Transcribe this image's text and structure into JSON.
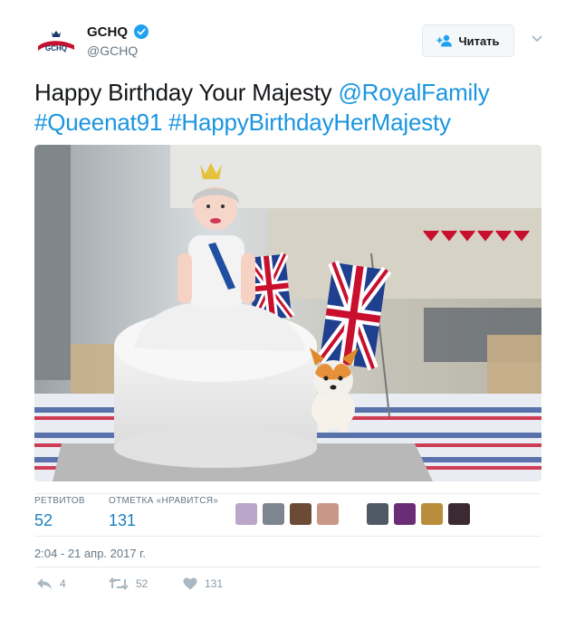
{
  "author": {
    "display_name": "GCHQ",
    "handle": "@GCHQ",
    "avatar_text": "GCHQ",
    "verified": true,
    "icon_verified": "verified-badge-icon"
  },
  "follow_button": {
    "label": "Читать",
    "icon": "follow-person-plus-icon"
  },
  "menu_caret": {
    "icon": "chevron-down-icon"
  },
  "tweet": {
    "text_plain_1": "Happy Birthday Your Majesty ",
    "mention": "@RoyalFamily",
    "hashtag_1": "#Queenat91",
    "hashtag_2": "#HappyBirthdayHerMajesty"
  },
  "media": {
    "description": "Cake shaped like the Queen with a corgi and Union Jack flags",
    "photo_caption": ""
  },
  "stats": {
    "retweets_label": "РЕТВИТОВ",
    "retweets_value": "52",
    "likes_label": "ОТМЕТКА «НРАВИТСЯ»",
    "likes_value": "131"
  },
  "likers": [
    {
      "name": "liker-1",
      "color": "#b9a6c9"
    },
    {
      "name": "liker-2",
      "color": "#7d8590"
    },
    {
      "name": "liker-3",
      "color": "#6b4b36"
    },
    {
      "name": "liker-4",
      "color": "#c99787"
    },
    {
      "name": "liker-5",
      "color": "#4f5a66"
    },
    {
      "name": "liker-6",
      "color": "#6a2c75"
    },
    {
      "name": "liker-7",
      "color": "#b88d3c"
    },
    {
      "name": "liker-8",
      "color": "#3b2a32"
    },
    {
      "name": "liker-9",
      "color": "#a3909a"
    }
  ],
  "timestamp": "2:04 - 21 апр. 2017 г.",
  "actions": {
    "reply_count": "4",
    "retweet_count": "52",
    "like_count": "131"
  },
  "colors": {
    "link": "#1b95e0",
    "stat_value": "#1b7fbf",
    "muted": "#657786",
    "divider": "#e6ecf0"
  }
}
